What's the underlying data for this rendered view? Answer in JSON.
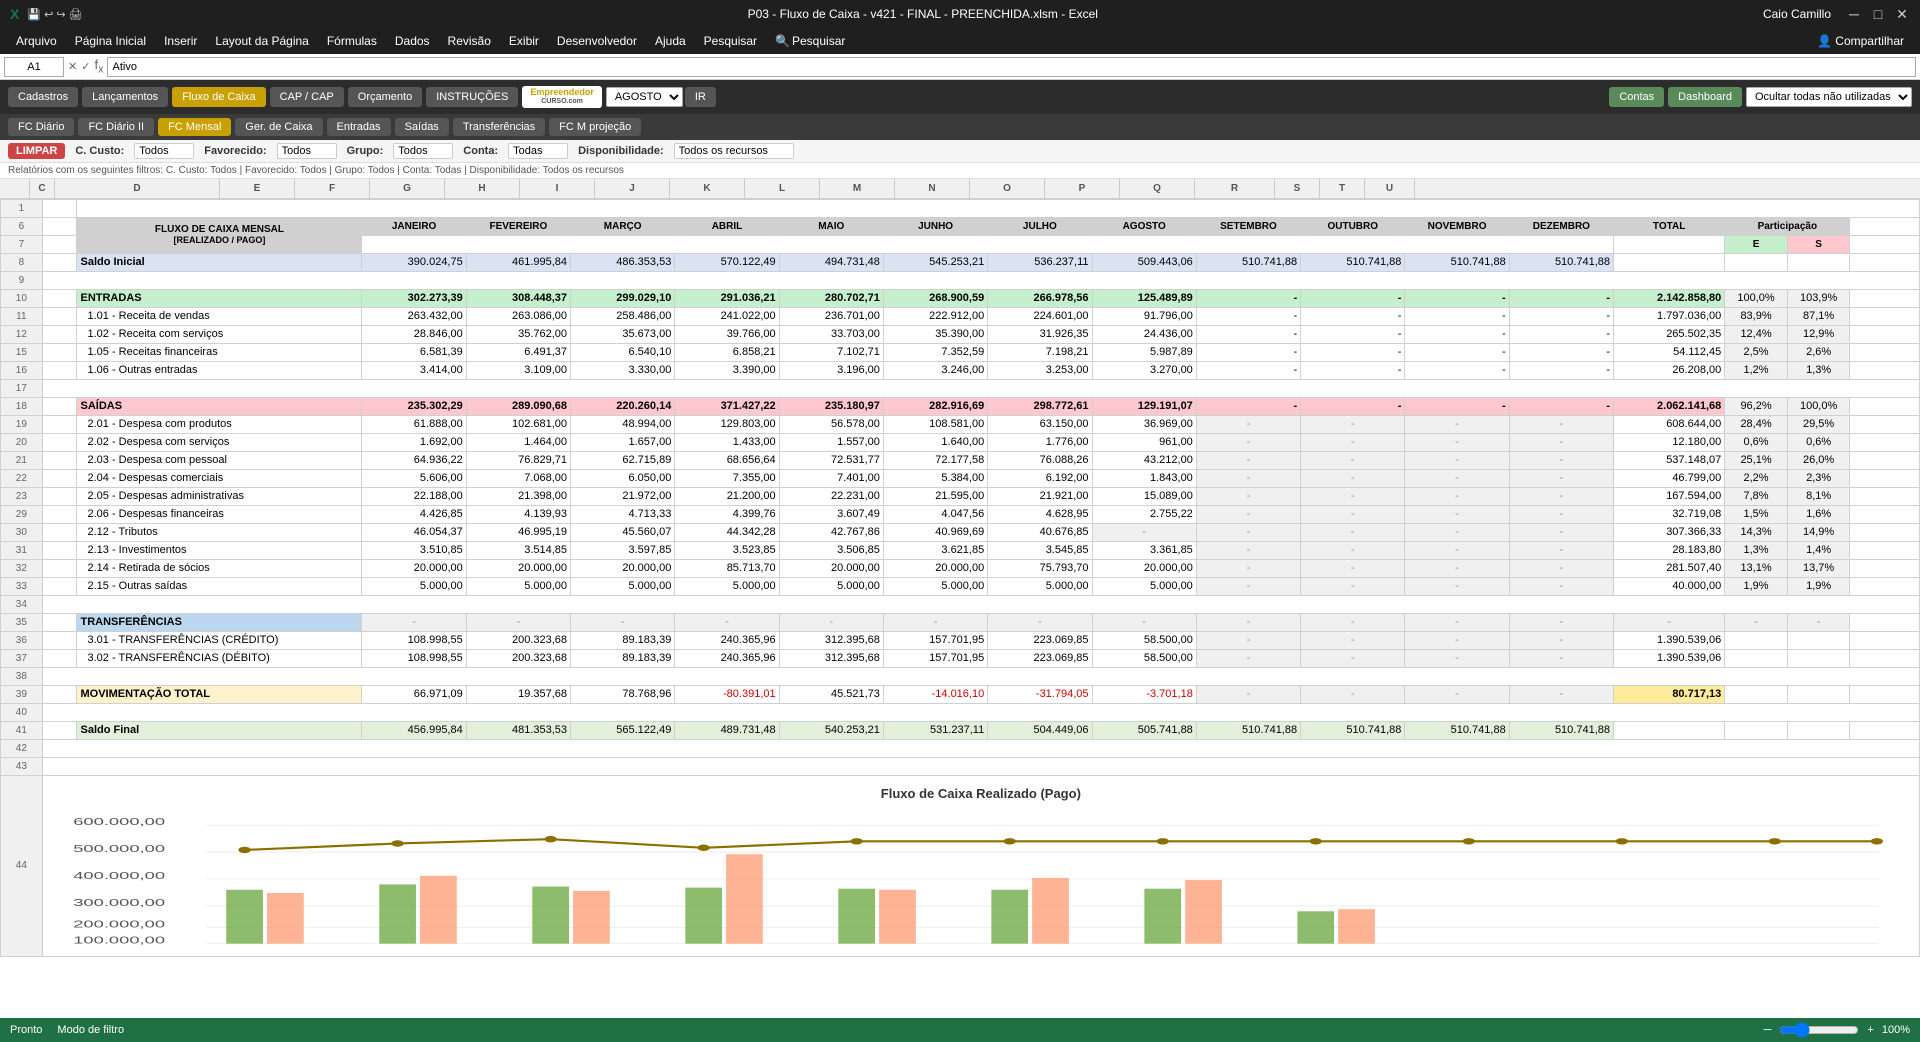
{
  "titleBar": {
    "title": "P03 - Fluxo de Caixa - v421 - FINAL - PREENCHIDA.xlsm - Excel",
    "user": "Caio Camillo"
  },
  "menuBar": {
    "items": [
      "Arquivo",
      "Página Inicial",
      "Inserir",
      "Layout da Página",
      "Fórmulas",
      "Dados",
      "Revisão",
      "Exibir",
      "Desenvolvedor",
      "Ajuda",
      "Pesquisar",
      "Pesquisar"
    ]
  },
  "formulaBar": {
    "cellRef": "A1",
    "formula": "Ativo"
  },
  "ribbon": {
    "buttons": [
      {
        "label": "Cadastros",
        "style": "default"
      },
      {
        "label": "Lançamentos",
        "style": "default"
      },
      {
        "label": "Fluxo de Caixa",
        "style": "active"
      },
      {
        "label": "CAP / CAP",
        "style": "default"
      },
      {
        "label": "Orçamento",
        "style": "default"
      },
      {
        "label": "INSTRUÇÕES",
        "style": "default"
      }
    ],
    "logo": {
      "line1": "Empreendedor",
      "line2": "CURSO.com"
    },
    "month": "AGOSTO",
    "irLabel": "IR",
    "rightButtons": [
      {
        "label": "Contas",
        "style": "green"
      },
      {
        "label": "Dashboard",
        "style": "green"
      }
    ],
    "hideLabel": "Ocultar todas não utilizadas"
  },
  "subToolbar": {
    "buttons": [
      {
        "label": "FC Diário",
        "style": "default"
      },
      {
        "label": "FC Diário II",
        "style": "default"
      },
      {
        "label": "FC Mensal",
        "style": "active"
      },
      {
        "label": "Ger. de Caixa",
        "style": "default"
      },
      {
        "label": "Entradas",
        "style": "default"
      },
      {
        "label": "Saídas",
        "style": "default"
      },
      {
        "label": "Transferências",
        "style": "default"
      },
      {
        "label": "FC M projeção",
        "style": "default"
      }
    ]
  },
  "filterBar": {
    "limpar": "LIMPAR",
    "cCusto": {
      "label": "C. Custo:",
      "value": "Todos"
    },
    "favorecido": {
      "label": "Favorecido:",
      "value": "Todos"
    },
    "grupo": {
      "label": "Grupo:",
      "value": "Todos"
    },
    "conta": {
      "label": "Conta:",
      "value": "Todas"
    },
    "disponibilidade": {
      "label": "Disponibilidade:",
      "value": "Todos os recursos"
    }
  },
  "filterInfo": "Relatórios com os seguintes filtros: C. Custo: Todos | Favorecido: Todos | Grupo: Todos | Conta: Todas | Disponibilidade: Todos os recursos",
  "tableHeaders": {
    "mainTitle": "FLUXO DE CAIXA MENSAL\n[REALIZADO / PAGO]",
    "months": [
      "JANEIRO",
      "FEVEREIRO",
      "MARÇO",
      "ABRIL",
      "MAIO",
      "JUNHO",
      "JULHO",
      "AGOSTO",
      "SETEMBRO",
      "OUTUBRO",
      "NOVEMBRO",
      "DEZEMBRO"
    ],
    "total": "TOTAL",
    "participacao": "Participação",
    "e": "E",
    "s": "S"
  },
  "rows": {
    "saldoInicial": {
      "label": "Saldo Inicial",
      "values": [
        "390.024,75",
        "461.995,84",
        "486.353,53",
        "570.122,49",
        "494.731,48",
        "545.253,21",
        "536.237,11",
        "509.443,06",
        "510.741,88",
        "510.741,88",
        "510.741,88",
        "510.741,88"
      ],
      "total": ""
    },
    "entradas": {
      "label": "ENTRADAS",
      "values": [
        "302.273,39",
        "308.448,37",
        "299.029,10",
        "291.036,21",
        "280.702,71",
        "268.900,59",
        "266.978,56",
        "125.489,89",
        "-",
        "-",
        "-",
        "-"
      ],
      "total": "2.142.858,80",
      "e": "100,0%",
      "s": "103,9%"
    },
    "e1_01": {
      "label": "1.01 - Receita de vendas",
      "values": [
        "263.432,00",
        "263.086,00",
        "258.486,00",
        "241.022,00",
        "236.701,00",
        "222.912,00",
        "224.601,00",
        "91.796,00",
        "-",
        "-",
        "-",
        "-"
      ],
      "total": "1.797.036,00",
      "e": "83,9%",
      "s": "87,1%"
    },
    "e1_02": {
      "label": "1.02 - Receita com serviços",
      "values": [
        "28.846,00",
        "35.762,00",
        "35.673,00",
        "39.766,00",
        "33.703,00",
        "35.390,00",
        "31.926,35",
        "24.436,00",
        "-",
        "-",
        "-",
        "-"
      ],
      "total": "265.502,35",
      "e": "12,4%",
      "s": "12,9%"
    },
    "e1_05": {
      "label": "1.05 - Receitas financeiras",
      "values": [
        "6.581,39",
        "6.491,37",
        "6.540,10",
        "6.858,21",
        "7.102,71",
        "7.352,59",
        "7.198,21",
        "5.987,89",
        "-",
        "-",
        "-",
        "-"
      ],
      "total": "54.112,45",
      "e": "2,5%",
      "s": "2,6%"
    },
    "e1_06": {
      "label": "1.06 - Outras entradas",
      "values": [
        "3.414,00",
        "3.109,00",
        "3.330,00",
        "3.390,00",
        "3.196,00",
        "3.246,00",
        "3.253,00",
        "3.270,00",
        "-",
        "-",
        "-",
        "-"
      ],
      "total": "26.208,00",
      "e": "1,2%",
      "s": "1,3%"
    },
    "saidas": {
      "label": "SAÍDAS",
      "values": [
        "235.302,29",
        "289.090,68",
        "220.260,14",
        "371.427,22",
        "235.180,97",
        "282.916,69",
        "298.772,61",
        "129.191,07",
        "-",
        "-",
        "-",
        "-"
      ],
      "total": "2.062.141,68",
      "e": "96,2%",
      "s": "100,0%"
    },
    "s2_01": {
      "label": "2.01 - Despesa com produtos",
      "values": [
        "61.888,00",
        "102.681,00",
        "48.994,00",
        "129.803,00",
        "56.578,00",
        "108.581,00",
        "63.150,00",
        "36.969,00",
        "-",
        "-",
        "-",
        "-"
      ],
      "total": "608.644,00",
      "e": "28,4%",
      "s": "29,5%"
    },
    "s2_02": {
      "label": "2.02 - Despesa com serviços",
      "values": [
        "1.692,00",
        "1.464,00",
        "1.657,00",
        "1.433,00",
        "1.557,00",
        "1.640,00",
        "1.776,00",
        "961,00",
        "-",
        "-",
        "-",
        "-"
      ],
      "total": "12.180,00",
      "e": "0,6%",
      "s": "0,6%"
    },
    "s2_03": {
      "label": "2.03 - Despesa com pessoal",
      "values": [
        "64.936,22",
        "76.829,71",
        "62.715,89",
        "68.656,64",
        "72.531,77",
        "72.177,58",
        "76.088,26",
        "43.212,00",
        "-",
        "-",
        "-",
        "-"
      ],
      "total": "537.148,07",
      "e": "25,1%",
      "s": "26,0%"
    },
    "s2_04": {
      "label": "2.04 - Despesas comerciais",
      "values": [
        "5.606,00",
        "7.068,00",
        "6.050,00",
        "7.355,00",
        "7.401,00",
        "5.384,00",
        "6.192,00",
        "1.843,00",
        "-",
        "-",
        "-",
        "-"
      ],
      "total": "46.799,00",
      "e": "2,2%",
      "s": "2,3%"
    },
    "s2_05": {
      "label": "2.05 - Despesas administrativas",
      "values": [
        "22.188,00",
        "21.398,00",
        "21.972,00",
        "21.200,00",
        "22.231,00",
        "21.595,00",
        "21.921,00",
        "15.089,00",
        "-",
        "-",
        "-",
        "-"
      ],
      "total": "167.594,00",
      "e": "7,8%",
      "s": "8,1%"
    },
    "s2_06": {
      "label": "2.06 - Despesas financeiras",
      "values": [
        "4.426,85",
        "4.139,93",
        "4.713,33",
        "4.399,76",
        "3.607,49",
        "4.047,56",
        "4.628,95",
        "2.755,22",
        "-",
        "-",
        "-",
        "-"
      ],
      "total": "32.719,08",
      "e": "1,5%",
      "s": "1,6%"
    },
    "s2_12": {
      "label": "2.12 - Tributos",
      "values": [
        "46.054,37",
        "46.995,19",
        "45.560,07",
        "44.342,28",
        "42.767,86",
        "40.969,69",
        "40.676,85",
        "-",
        "-",
        "-",
        "-",
        "-"
      ],
      "total": "307.366,33",
      "e": "14,3%",
      "s": "14,9%"
    },
    "s2_13": {
      "label": "2.13 - Investimentos",
      "values": [
        "3.510,85",
        "3.514,85",
        "3.597,85",
        "3.523,85",
        "3.506,85",
        "3.621,85",
        "3.545,85",
        "3.361,85",
        "-",
        "-",
        "-",
        "-"
      ],
      "total": "28.183,80",
      "e": "1,3%",
      "s": "1,4%"
    },
    "s2_14": {
      "label": "2.14 - Retirada de sócios",
      "values": [
        "20.000,00",
        "20.000,00",
        "20.000,00",
        "85.713,70",
        "20.000,00",
        "20.000,00",
        "75.793,70",
        "20.000,00",
        "-",
        "-",
        "-",
        "-"
      ],
      "total": "281.507,40",
      "e": "13,1%",
      "s": "13,7%"
    },
    "s2_15": {
      "label": "2.15 - Outras saídas",
      "values": [
        "5.000,00",
        "5.000,00",
        "5.000,00",
        "5.000,00",
        "5.000,00",
        "5.000,00",
        "5.000,00",
        "5.000,00",
        "-",
        "-",
        "-",
        "-"
      ],
      "total": "40.000,00",
      "e": "1,9%",
      "s": "1,9%"
    },
    "transferencias": {
      "label": "TRANSFERÊNCIAS",
      "values": [
        "-",
        "-",
        "-",
        "-",
        "-",
        "-",
        "-",
        "-",
        "-",
        "-",
        "-",
        "-"
      ],
      "total": "-",
      "e": "-",
      "s": "-"
    },
    "t3_01": {
      "label": "3.01 - TRANSFERÊNCIAS (CRÉDITO)",
      "values": [
        "108.998,55",
        "200.323,68",
        "89.183,39",
        "240.365,96",
        "312.395,68",
        "157.701,95",
        "223.069,85",
        "58.500,00",
        "-",
        "-",
        "-",
        "-"
      ],
      "total": "1.390.539,06"
    },
    "t3_02": {
      "label": "3.02 - TRANSFERÊNCIAS (DÉBITO)",
      "values": [
        "108.998,55",
        "200.323,68",
        "89.183,39",
        "240.365,96",
        "312.395,68",
        "157.701,95",
        "223.069,85",
        "58.500,00",
        "-",
        "-",
        "-",
        "-"
      ],
      "total": "1.390.539,06"
    },
    "movimentacao": {
      "label": "MOVIMENTAÇÃO TOTAL",
      "values": [
        "66.971,09",
        "19.357,68",
        "78.768,96",
        "-80.391,01",
        "45.521,73",
        "-14.016,10",
        "-31.794,05",
        "-3.701,18",
        "-",
        "-",
        "-",
        "-"
      ],
      "total": "80.717,13"
    },
    "saldoFinal": {
      "label": "Saldo Final",
      "values": [
        "456.995,84",
        "481.353,53",
        "565.122,49",
        "489.731,48",
        "540.253,21",
        "531.237,11",
        "504.449,06",
        "505.741,88",
        "510.741,88",
        "510.741,88",
        "510.741,88",
        "510.741,88"
      ],
      "total": ""
    }
  },
  "colWidths": {
    "rowNum": 25,
    "description": 165,
    "month": 75,
    "total": 80,
    "participacao": 45
  },
  "chart": {
    "title": "Fluxo de Caixa Realizado (Pago)",
    "lineColor": "#8b7000",
    "barGreen": "#70ad47",
    "barSalmon": "#ffa07a"
  },
  "statusBar": {
    "left": [
      "Pronto",
      "Modo de filtro"
    ],
    "zoom": "100%"
  }
}
